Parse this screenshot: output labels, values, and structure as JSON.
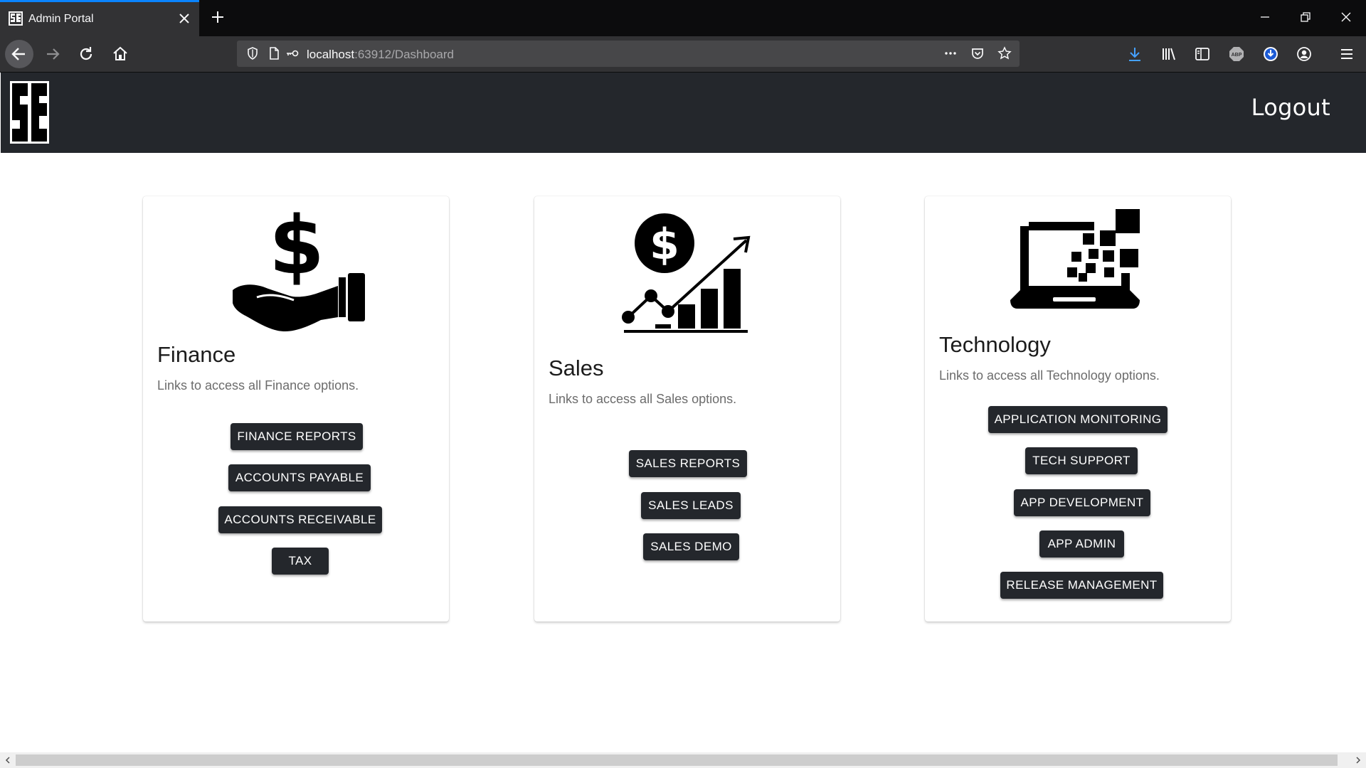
{
  "browser": {
    "tab_title": "Admin Portal",
    "url_host": "localhost",
    "url_rest": ":63912/Dashboard"
  },
  "header": {
    "logo_text": "SE",
    "logout_label": "Logout"
  },
  "cards": [
    {
      "title": "Finance",
      "description": "Links to access all Finance options.",
      "icon": "hand-holding-dollar-icon",
      "buttons": [
        "FINANCE REPORTS",
        "ACCOUNTS PAYABLE",
        "ACCOUNTS RECEIVABLE",
        "TAX"
      ]
    },
    {
      "title": "Sales",
      "description": "Links to access all Sales options.",
      "icon": "sales-growth-chart-icon",
      "buttons": [
        "SALES REPORTS",
        "SALES LEADS",
        "SALES DEMO"
      ]
    },
    {
      "title": "Technology",
      "description": "Links to access all Technology options.",
      "icon": "digital-laptop-icon",
      "buttons": [
        "APPLICATION MONITORING",
        "TECH SUPPORT",
        "APP DEVELOPMENT",
        "APP ADMIN",
        "RELEASE MANAGEMENT"
      ]
    }
  ],
  "colors": {
    "header_bg": "#24272c",
    "button_bg": "#24272c",
    "tab_accent": "#0a84ff"
  }
}
